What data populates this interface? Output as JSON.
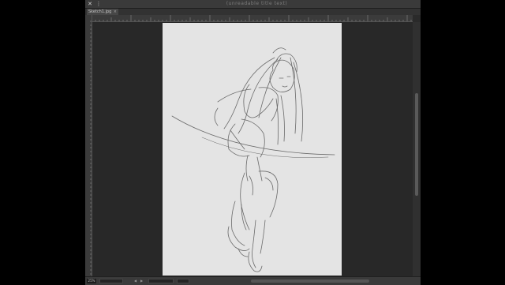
{
  "window": {
    "title": "(unreadable title text)",
    "close_glyph": "✕",
    "menu_glyph": "⋮"
  },
  "tabs": [
    {
      "label": "Sketch1.jpg",
      "close_glyph": "×"
    }
  ],
  "status": {
    "zoom": "25%",
    "nav_prev": "◀",
    "nav_next": "▶"
  },
  "colors": {
    "workspace": "#282828",
    "paper": "#e4e4e4",
    "sketch_stroke": "#555555"
  }
}
